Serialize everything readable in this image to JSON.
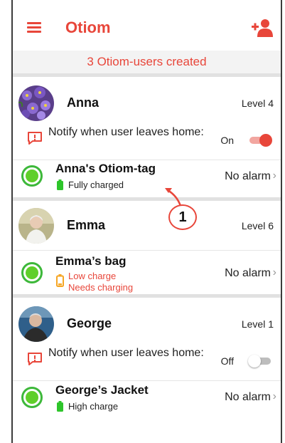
{
  "app": {
    "title": "Otiom"
  },
  "banner": {
    "text": "3 Otiom-users created"
  },
  "users": [
    {
      "name": "Anna",
      "level": "Level 4",
      "notify": {
        "label": "Notify when user leaves home:",
        "state": "On",
        "enabled": true
      },
      "tag": {
        "name": "Anna's Otiom-tag",
        "status_lines": [
          "Fully charged"
        ],
        "alarm": "No alarm",
        "battery": 1.0,
        "battery_color": "#2ec52b"
      }
    },
    {
      "name": "Emma",
      "level": "Level 6",
      "tag": {
        "name": "Emma’s bag",
        "status_lines": [
          "Low charge",
          "Needs charging"
        ],
        "alarm": "No alarm",
        "battery": 0.15,
        "battery_color": "#f6a623"
      }
    },
    {
      "name": "George",
      "level": "Level 1",
      "notify": {
        "label": "Notify when user leaves home:",
        "state": "Off",
        "enabled": false
      },
      "tag": {
        "name": "George’s Jacket",
        "status_lines": [
          "High charge"
        ],
        "alarm": "No alarm",
        "battery": 0.9,
        "battery_color": "#2ec52b"
      }
    }
  ],
  "callout": {
    "label": "1"
  },
  "colors": {
    "accent": "#e8463a",
    "ok_green": "#3db83a",
    "toggle_off": "#bdbdbd"
  }
}
